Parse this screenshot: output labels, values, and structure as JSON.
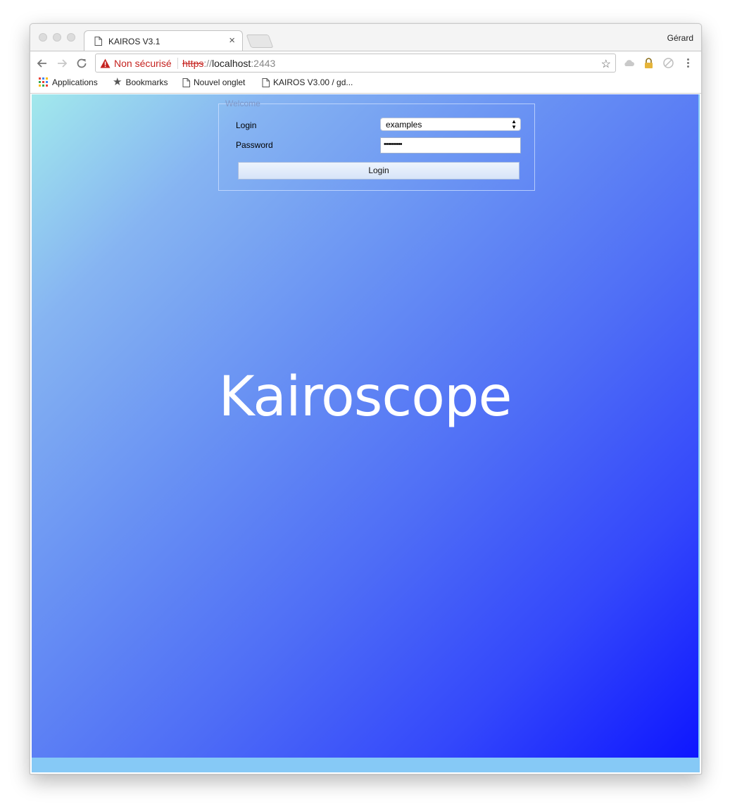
{
  "browser": {
    "tab": {
      "title": "KAIROS V3.1",
      "close_glyph": "×"
    },
    "profile_name": "Gérard",
    "address_bar": {
      "security_label": "Non sécurisé",
      "url_scheme": "https",
      "url_separator": "://",
      "url_host": "localhost",
      "url_port": ":2443"
    },
    "bookmarks": [
      {
        "label": "Applications",
        "icon": "apps-grid-icon"
      },
      {
        "label": "Bookmarks",
        "icon": "star-icon"
      },
      {
        "label": "Nouvel onglet",
        "icon": "page-icon"
      },
      {
        "label": "KAIROS V3.00 / gd...",
        "icon": "page-icon"
      }
    ]
  },
  "login_form": {
    "legend": "Welcome",
    "login_label": "Login",
    "login_value": "examples",
    "password_label": "Password",
    "password_value": "•••••••••",
    "submit_label": "Login"
  },
  "brand": {
    "name": "Kairoscope"
  },
  "colors": {
    "gradient_start": "#a2e9ec",
    "gradient_end": "#0e16ff",
    "footer_bar": "#86c9f6",
    "security_warning": "#c5221f"
  }
}
